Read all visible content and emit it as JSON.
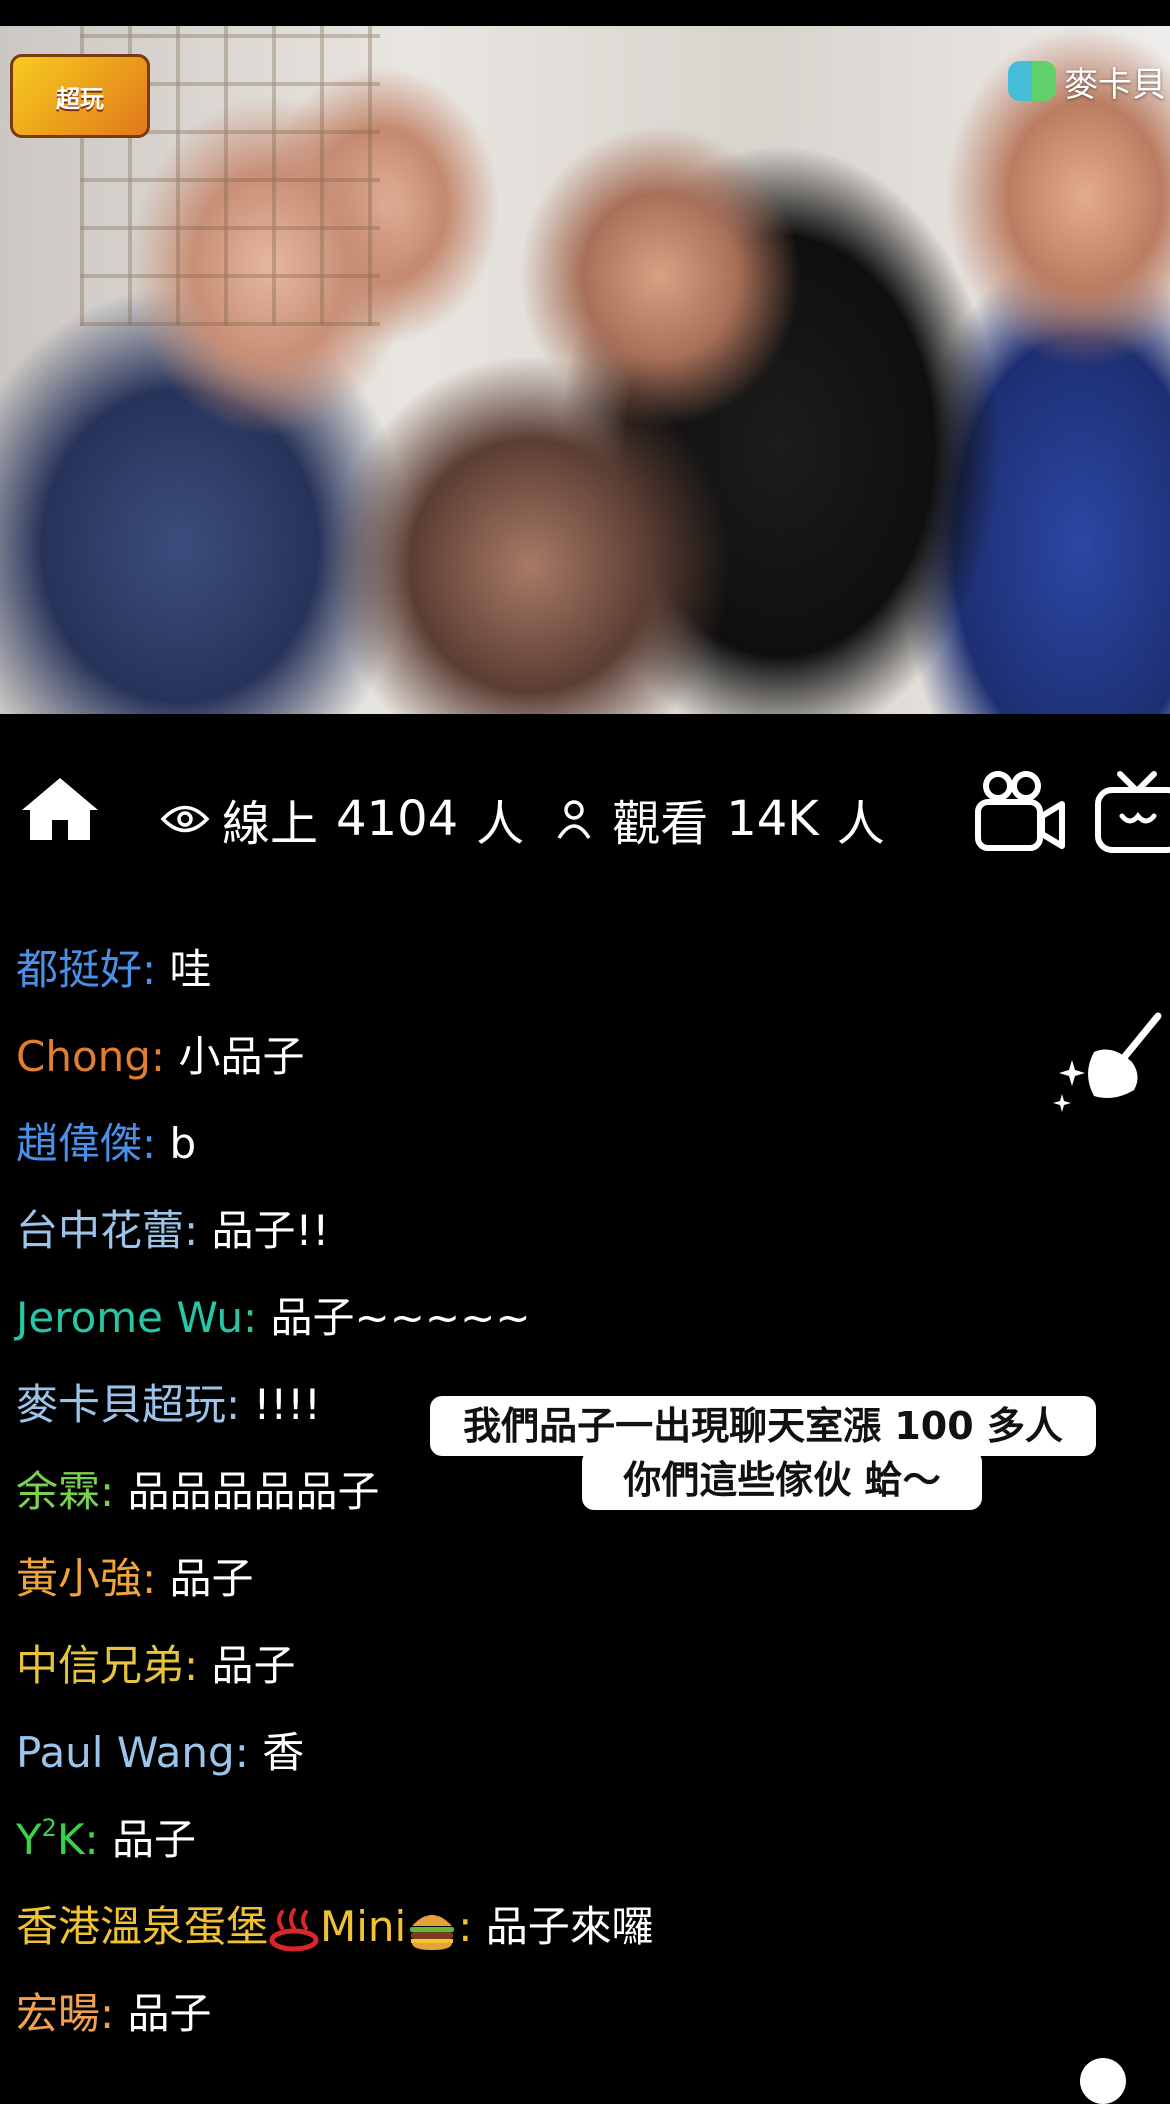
{
  "video": {
    "show_logo": "超玩",
    "channel_logo": "麥卡貝"
  },
  "infobar": {
    "online_label": "線上",
    "online_count": "4104",
    "online_unit": "人",
    "viewers_label": "觀看",
    "viewers_count": "14K",
    "viewers_unit": "人",
    "icons": [
      "home-icon",
      "eye-icon",
      "person-icon",
      "video-camera-icon",
      "tv-icon",
      "broom-sparkle-icon",
      "close-icon"
    ]
  },
  "chat": [
    {
      "name": "都挺好",
      "text": "哇",
      "color": "#4a90e8"
    },
    {
      "name": "Chong",
      "text": "小品子",
      "color": "#e07e32"
    },
    {
      "name": "趙偉傑",
      "text": "b",
      "color": "#4a90e8"
    },
    {
      "name": "台中花蕾",
      "text": "品子!!",
      "color": "#9cc4ea"
    },
    {
      "name": "Jerome Wu",
      "text": "品子~~~~~",
      "color": "#26c6a6"
    },
    {
      "name": "麥卡貝超玩",
      "text": "!!!!",
      "color": "#9cc4ea"
    },
    {
      "name": "余霖",
      "text": "品品品品品子",
      "color": "#79d24e"
    },
    {
      "name": "黃小強",
      "text": "品子",
      "color": "#f1a43b"
    },
    {
      "name": "中信兄弟",
      "text": "品子",
      "color": "#e7c43c"
    },
    {
      "name": "Paul Wang",
      "text": "香",
      "color": "#9cc4ea"
    },
    {
      "name_prefix": "Y",
      "name_sup": "2",
      "name_suffix": "K",
      "text": "品子",
      "color": "#3ad24a"
    },
    {
      "name_part1": "香港溫泉蛋堡",
      "name_part2": "Mini",
      "text": "品子來囉",
      "color": "#f1c232"
    },
    {
      "name": "宏暘",
      "text": "品子",
      "color": "#f0a050"
    }
  ],
  "caption": {
    "line1": "我們品子一出現聊天室漲 100 多人",
    "line2": "你們這些傢伙 蛤～"
  }
}
